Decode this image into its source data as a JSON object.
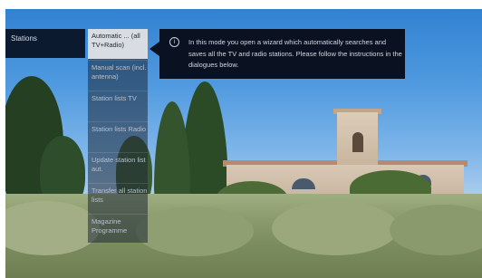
{
  "side_panel": {
    "title": "Stations"
  },
  "menu": {
    "items": [
      {
        "label": "Automatic ... (all TV+Radio)",
        "selected": true
      },
      {
        "label": "Manual scan (incl. antenna)",
        "selected": false
      },
      {
        "label": "Station lists TV",
        "selected": false
      },
      {
        "label": "Station lists Radio",
        "selected": false
      },
      {
        "label": "Update station list aut.",
        "selected": false
      },
      {
        "label": "Transfer all station lists",
        "selected": false
      },
      {
        "label": "Magazine Programme",
        "selected": false
      }
    ]
  },
  "info": {
    "icon": "info-icon",
    "text": "In this mode you open a wizard which automatically searches and saves all the TV and radio stations. Please follow the instructions in the dialogues below."
  },
  "colors": {
    "panel_dark": "#0a1222",
    "selected_item": "#d9dde3",
    "menu_text": "#b9c0cb"
  }
}
